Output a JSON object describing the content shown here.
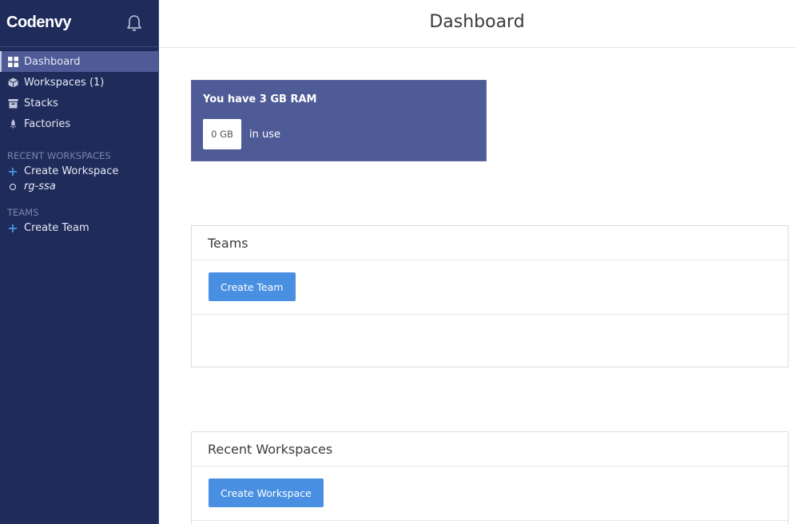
{
  "sidebar": {
    "brand": "Codenvy",
    "nav": [
      {
        "label": "Dashboard",
        "icon": "dashboard-grid-icon",
        "active": true
      },
      {
        "label": "Workspaces (1)",
        "icon": "cube-icon",
        "active": false
      },
      {
        "label": "Stacks",
        "icon": "box-icon",
        "active": false
      },
      {
        "label": "Factories",
        "icon": "rocket-icon",
        "active": false
      }
    ],
    "recent_title": "RECENT WORKSPACES",
    "recent_items": [
      {
        "label": "Create Workspace",
        "icon": "plus-icon"
      },
      {
        "label": "rg-ssa",
        "icon": "circle-icon"
      }
    ],
    "teams_title": "TEAMS",
    "team_items": [
      {
        "label": "Create Team",
        "icon": "plus-icon"
      }
    ]
  },
  "header": {
    "title": "Dashboard"
  },
  "ram": {
    "title": "You have 3 GB RAM",
    "value": "0 GB",
    "suffix": "in use"
  },
  "teams_panel": {
    "title": "Teams",
    "button": "Create Team"
  },
  "recent_panel": {
    "title": "Recent Workspaces",
    "button": "Create Workspace"
  },
  "colors": {
    "sidebar_bg": "#1f2b5a",
    "active_bg": "#4e5b97",
    "accent": "#4a90e2"
  }
}
